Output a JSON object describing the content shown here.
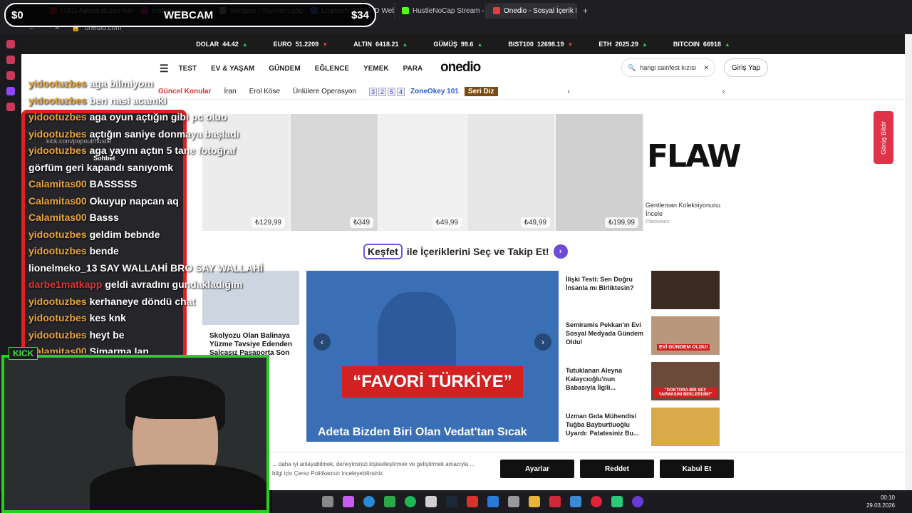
{
  "browser": {
    "tabs": [
      {
        "label": "(181) Adaya düşen hangi",
        "color": "#e02020"
      },
      {
        "label": "Instagram",
        "color": "#d6249f"
      },
      {
        "label": "Widgets | Yayınımı güçlend",
        "color": "#9a9a9a"
      },
      {
        "label": "Logitech C270 HD Web",
        "color": "#3a7be0"
      },
      {
        "label": "HustleNoCap Stream - Wa",
        "color": "#53fc18"
      },
      {
        "label": "Onedio - Sosyal İçerik Plat",
        "color": "#e04040"
      }
    ],
    "url": "onedio.com"
  },
  "overlay": {
    "money_left": "$0",
    "webcam_label": "WEBCAM",
    "money_right": "$34",
    "kick_label": "KICK",
    "popout_url": "kick.com/popout/hustle",
    "sohbet": "Sohbet"
  },
  "ticker": [
    {
      "name": "DOLAR",
      "value": "44.42",
      "dir": "up"
    },
    {
      "name": "EURO",
      "value": "51.2209",
      "dir": "down"
    },
    {
      "name": "ALTIN",
      "value": "6418.21",
      "dir": "up"
    },
    {
      "name": "GÜMÜŞ",
      "value": "99.6",
      "dir": "up"
    },
    {
      "name": "BIST100",
      "value": "12698.19",
      "dir": "down"
    },
    {
      "name": "ETH",
      "value": "2025.29",
      "dir": "up"
    },
    {
      "name": "BITCOIN",
      "value": "66918",
      "dir": "up"
    }
  ],
  "nav": {
    "links": [
      "TEST",
      "EV & YAŞAM",
      "GÜNDEM",
      "EĞLENCE",
      "YEMEK",
      "PARA"
    ],
    "logo": "onedio",
    "search_value": "hangi sainfest kızısı",
    "login": "Giriş Yap"
  },
  "topics": {
    "title": "Güncel Konular",
    "items": [
      "İran",
      "Erol Köse",
      "Ünlülere Operasyon",
      "ZoneOkey 101",
      "Seri Diz"
    ],
    "zone_digits": [
      "3",
      "2",
      "5",
      "4"
    ]
  },
  "ad": {
    "prices": [
      "₺129,99",
      "₺349",
      "₺49,99",
      "₺49,99",
      "₺199,99"
    ],
    "brand": "FLAW",
    "cta_title": "Gentleman Koleksiyonunu İncele",
    "cta_sub": "Flawwears"
  },
  "kesfet": {
    "box": "Keşfet",
    "text": "ile İçeriklerini Seç ve Takip Et!"
  },
  "feedback": "Görüş Bildir",
  "articles": {
    "left_title": "Skolyozu Olan Balinaya Yüzme Tavsiye Edenden Salçasız Pasaporta Son ...etleri",
    "hero_banner": "“FAVORİ TÜRKİYE”",
    "hero_title": "Adeta Bizden Biri Olan Vedat'tan Sıcak",
    "side": [
      {
        "title": "İlişki Testi: Sen Doğru İnsanla mı Birliktesin?"
      },
      {
        "title": "Semiramis Pekkan'ın Evi Sosyal Medyada Gündem Oldu!",
        "badge": "EVİ GÜNDEM OLDU!"
      },
      {
        "title": "Tutuklanan Aleyna Kalaycıoğlu'nun Babasıyla İlgili...",
        "badge": "\"DOKTORA BİR SEY YAPMASINI BEKLERDİM!\""
      },
      {
        "title": "Uzman Gıda Mühendisi Tuğba Bayburtluoğlu Uyardı: Patatesiniz Bu..."
      }
    ]
  },
  "cookie": {
    "text": "... daha iyi anlayabilmek, deneyiminizi kişiselleştirmek ve geliştirmek amacıyla ... bilgi için Çerez Politikamızı inceleyebilirsiniz.",
    "buttons": [
      "Ayarlar",
      "Reddet",
      "Kabul Et"
    ]
  },
  "chat": [
    {
      "user": "yidootuzbes",
      "msg": "aga bilmiyom",
      "color": "u"
    },
    {
      "user": "yidootuzbes",
      "msg": "ben nasi acamki",
      "color": "u"
    },
    {
      "user": "yidootuzbes",
      "msg": "aga oyun açtığın gibi pc oluo",
      "color": "u"
    },
    {
      "user": "yidootuzbes",
      "msg": "açtığın saniye donmaya başladı",
      "color": "u"
    },
    {
      "user": "yidootuzbes",
      "msg": "aga yayını açtın 5 tane fotoğraf",
      "color": "u"
    },
    {
      "user": "",
      "msg": "görfüm geri kapandı sanıyomk",
      "color": "u"
    },
    {
      "user": "Calamitas00",
      "msg": "BASSSSS",
      "color": "u"
    },
    {
      "user": "Calamitas00",
      "msg": "Okuyup napcan aq",
      "color": "u"
    },
    {
      "user": "Calamitas00",
      "msg": "Basss",
      "color": "u"
    },
    {
      "user": "yidootuzbes",
      "msg": "geldim bebnde",
      "color": "u"
    },
    {
      "user": "yidootuzbes",
      "msg": "bende",
      "color": "u"
    },
    {
      "user": "lionelmeko_13",
      "msg": "SAY WALLAHİ BRO SAY WALLAHİ",
      "color": "u c2"
    },
    {
      "user": "darbe1matkapp",
      "msg": "geldi avradını gundakladığım",
      "color": "u c3"
    },
    {
      "user": "yidootuzbes",
      "msg": "kerhaneye döndü chat",
      "color": "u"
    },
    {
      "user": "yidootuzbes",
      "msg": "kes knk",
      "color": "u"
    },
    {
      "user": "yidootuzbes",
      "msg": "heyt be",
      "color": "u"
    },
    {
      "user": "Calamitas00",
      "msg": "Simarma lan",
      "color": "u"
    }
  ],
  "taskbar": {
    "time": "00:10",
    "date": "29.03.2026"
  }
}
